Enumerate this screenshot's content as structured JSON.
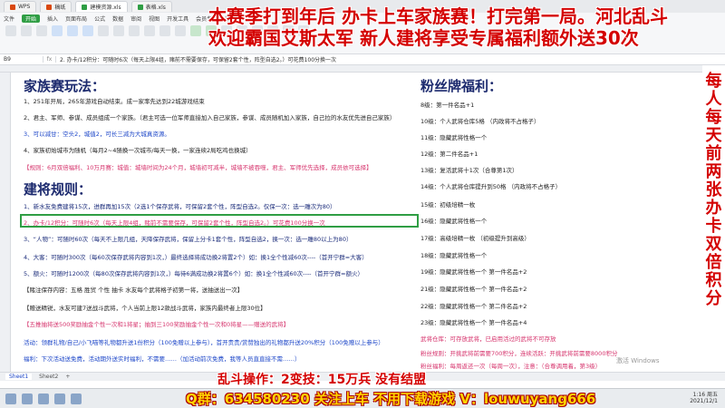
{
  "tabs": [
    {
      "label": "WPS",
      "active": false
    },
    {
      "label": "稿纸",
      "active": false
    },
    {
      "label": "建模资源.xls",
      "active": true
    },
    {
      "label": "表格.xls",
      "active": false
    }
  ],
  "menu": [
    "文件",
    "开始",
    "插入",
    "页面布局",
    "公式",
    "数据",
    "审阅",
    "视图",
    "开发工具",
    "会员专享",
    "效率"
  ],
  "menu_active": "开始",
  "formula_bar": {
    "cell_ref": "B9",
    "fx": "fx",
    "content": "2. 办卡/12积分：可随时6次（每天上限4组，赌前不需要保存，可保留2套个性，阵型自选2。）可花费100分换一次"
  },
  "overlay": {
    "line1": "本赛季打到年后  办卡上车家族赛！打完第一局。河北乱斗",
    "line2": "欢迎霸国艾斯太军  新人建将享受专属福利额外送30次"
  },
  "vertical_banner": "每人每天前两张办卡双倍积分",
  "left": {
    "heading1": "家族赛玩法：",
    "rules": [
      "1、251年开局，265年游戏自动结束。成一家率先达到22城游戏结束",
      "2、君主、军师、参谋、成员组成一个家族。（君主可选一位军师直接加入自己家族，参谋、成员随机加入家族，自己拉的水友优先进自己家族）",
      "3、可以减甘：空头2，城值2，可长三减为大城真资源。",
      "4、家族初始城市为随机（每月2~4随换一次城市/每天一换，一家连续2局吃鸡也换城）",
      "【规则：6月双倍福利、10万月赛：城值：城墙时间为24个月，城墙初可减半，城墙不被吞噬，君主、军师优先选择，成员依可选择】"
    ],
    "heading2": "建将规则：",
    "build": [
      "1、新水友免费建将15次，进群再加15次（2选1个保存武将，可保留2套个性，阵型自选2。仅保一次：选一雕次为80）",
      "2、办卡/12积分：可随时6次（每天上限4组，赌前不需要保存，可保留2套个性，阵型自选2。）可花费100分换一次",
      "3、“人物”：可随时60次（每天不上限几组，天降保存武将，保留上分卡1套个性，阵型自选2，换一次：选一雕80以上为80）",
      "4、大客：可随时300次（每60次保存武将内容到1次，）最终选择将成功换2将置2个）如：换1全个性减60次----（首开宁群=大客）",
      "5、额火：可随时1200次（每80次保存武将内容到1次，）每待6满成功换2将置6个）如：换1全个性减60次----（首开宁群=额火）",
      "【赌注保存内容：五格 胜贸 个性 抽卡 水友每个武将格子初第一将，送抽送出一次】",
      "【赠送精锐，水友可建7送战斗武将，个人当前上限12款战斗武将，家族内最终者上限30位】",
      "【五推抽将送500奖励抽金个性一次和1将星；抽到三100奖励抽金个性一次和0将星——赠送的武将】",
      "活动：领群礼物/自己/小飞喵等礼物都升送1份积分（100免赠以上参与），首开责贵/赏赞独出的礼物都升送20%积分（100免赠以上参与）",
      "福利：下次活动送免费，活动期外送实时福利，不需要……（加活动前次免费，我等人员直直接不需……）"
    ]
  },
  "right": {
    "heading": "粉丝牌福利：",
    "perks": [
      "8级：第一件名品+1",
      "10级：个人武将仓库5格  （内政将不占格子）",
      "11级：隐藏武将性格一个",
      "12级：第二件名品+1",
      "13级：复活武将十1次（合尊第1次）",
      "14级：个人武将仓库提升到50格  （内政将不占格子）",
      "15级：初级培精一枚",
      "16级：隐藏武将性格一个",
      "17级：高级培精一枚  （初级提升到高级）",
      "18级：隐藏武将性格一个",
      "19级：隐藏武将性格一个   第一件名品+2",
      "21级：隐藏武将性格一个   第一件名品+2",
      "22级：隐藏武将性格一个   第二件名品+2",
      "23级：隐藏武将性格一个   第一件名品+4",
      "武将仓库：可存放武将，已启用活过的武将不可存放",
      "粉丝规则：开挑武将前需要700积分，连续活跃：开挑武将前需要8000积分",
      "粉丝福利：每周返还一次（每周一次），注意：（合尊调用着，第3级）"
    ]
  },
  "sheet_tabs": [
    "Sheet1",
    "Sheet2",
    "+"
  ],
  "bottom": {
    "line1": "乱斗操作：2变技：15万兵     没有结盟",
    "line2": "Q群：634580230 关注上车 不用下载游戏 V：louwuyang666"
  },
  "watermark": "激活 Windows",
  "clock": {
    "time": "1:16 周五",
    "date": "2021/12/1"
  }
}
